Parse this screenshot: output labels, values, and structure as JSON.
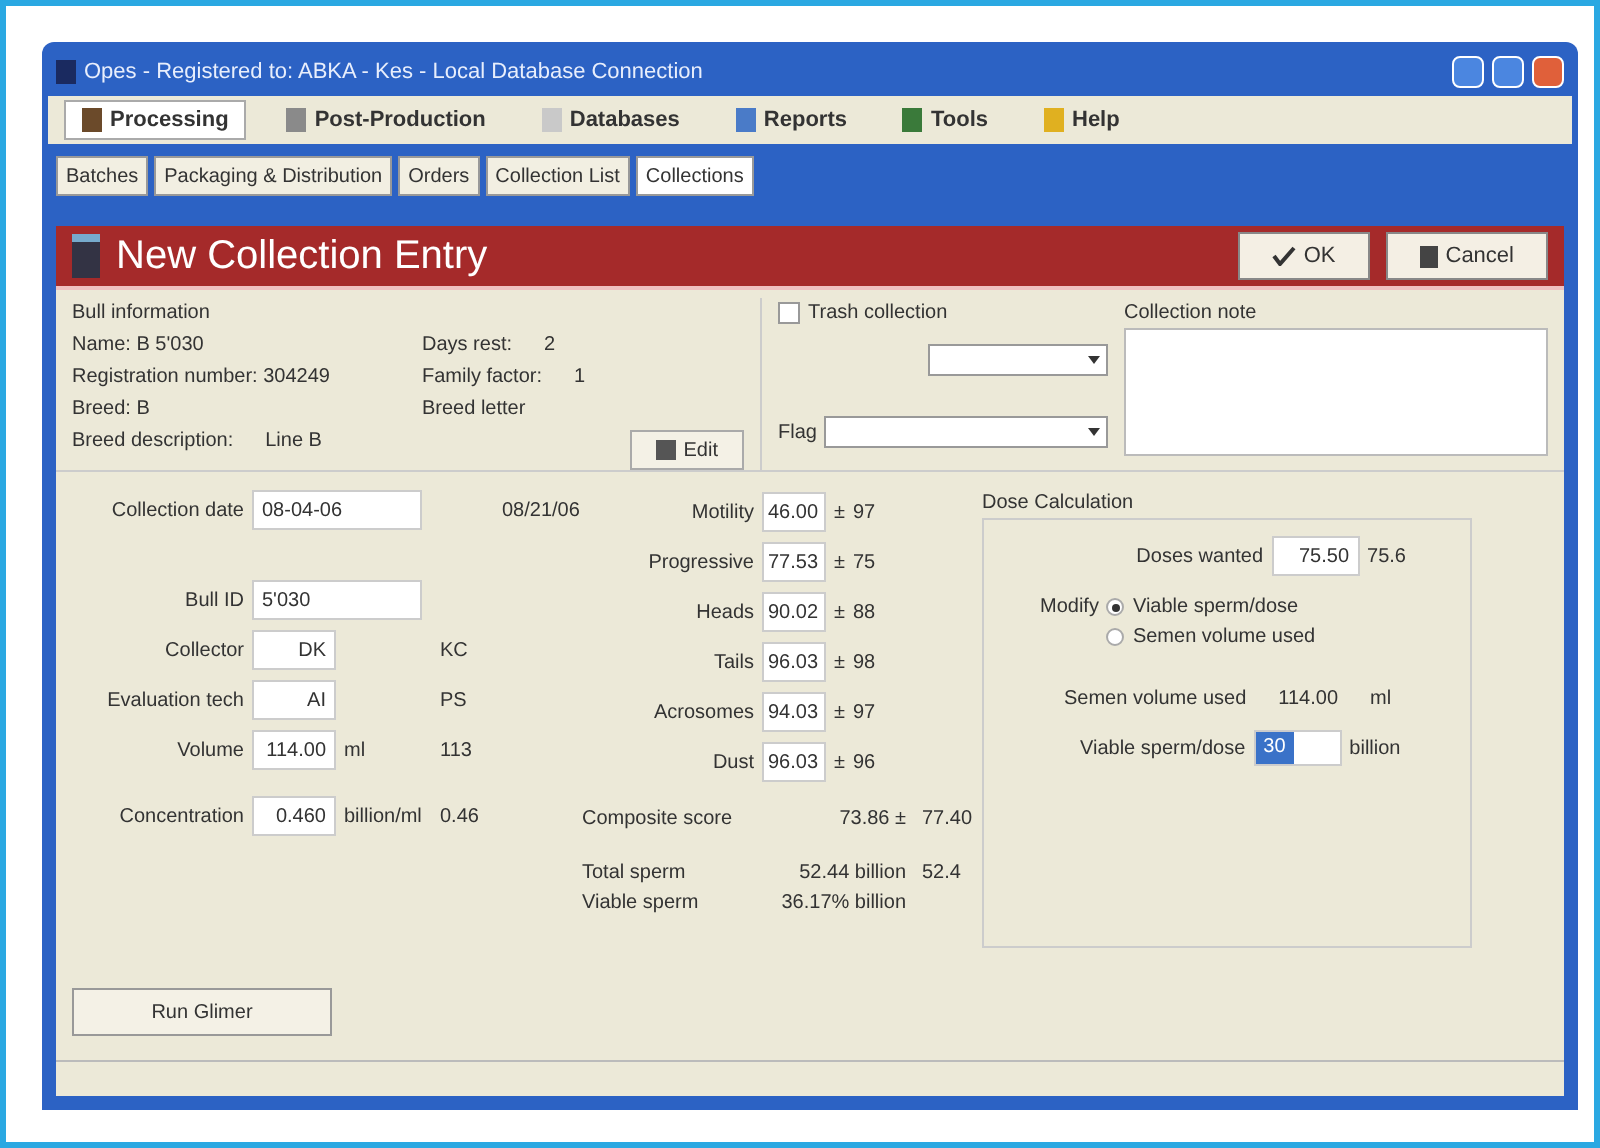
{
  "window": {
    "title": "Opes - Registered to: ABKA - Kes - Local Database Connection"
  },
  "menu": [
    {
      "label": "Processing",
      "selected": true
    },
    {
      "label": "Post-Production",
      "selected": false
    },
    {
      "label": "Databases",
      "selected": false
    },
    {
      "label": "Reports",
      "selected": false
    },
    {
      "label": "Tools",
      "selected": false
    },
    {
      "label": "Help",
      "selected": false
    }
  ],
  "tabs": [
    {
      "label": "Batches",
      "selected": false
    },
    {
      "label": "Packaging & Distribution",
      "selected": false
    },
    {
      "label": "Orders",
      "selected": false
    },
    {
      "label": "Collection List",
      "selected": false
    },
    {
      "label": "Collections",
      "selected": true
    }
  ],
  "header": {
    "title": "New Collection Entry",
    "ok": "OK",
    "cancel": "Cancel"
  },
  "bull_info": {
    "heading": "Bull information",
    "rows": [
      {
        "left": "Name: B 5'030",
        "right": "Days rest:",
        "right_value": "2"
      },
      {
        "left": "Registration number: 304249",
        "right": "Family factor:",
        "right_value": "1"
      },
      {
        "left": "Breed: B",
        "right": "Breed letter"
      },
      {
        "left": "Breed description:",
        "left_value": "Line B"
      }
    ],
    "edit_button": "Edit"
  },
  "trash_collection": {
    "label": "Trash collection",
    "checked": false
  },
  "flag": {
    "label": "Flag"
  },
  "collection_note": {
    "label": "Collection note"
  },
  "fields": [
    {
      "label": "Collection date",
      "value": "08-04-06",
      "kind": "wide",
      "reference": "08/21/06"
    },
    {
      "label": "Bull ID",
      "value": "5'030",
      "kind": "wide"
    },
    {
      "label": "Collector",
      "value": "DK",
      "kind": "narrow",
      "reference": "KC"
    },
    {
      "label": "Evaluation tech",
      "value": "AI",
      "kind": "narrow",
      "reference": "PS"
    },
    {
      "label": "Volume",
      "value": "114.00",
      "unit": "ml",
      "kind": "narrow",
      "reference": "113"
    },
    {
      "label": "Concentration",
      "value": "0.460",
      "unit": "billion/ml",
      "kind": "narrow",
      "reference": "0.46"
    }
  ],
  "scores": [
    {
      "label": "Motility",
      "value": "46.00",
      "sign": "±",
      "reference": "97"
    },
    {
      "label": "Progressive",
      "value": "77.53",
      "sign": "±",
      "reference": "75"
    },
    {
      "label": "Heads",
      "value": "90.02",
      "sign": "±",
      "reference": "88"
    },
    {
      "label": "Tails",
      "value": "96.03",
      "sign": "±",
      "reference": "98"
    },
    {
      "label": "Acrosomes",
      "value": "94.03",
      "sign": "±",
      "reference": "97"
    },
    {
      "label": "Dust",
      "value": "96.03",
      "sign": "±",
      "reference": "96"
    }
  ],
  "summary": [
    {
      "label": "Composite score",
      "value": "73.86 ±",
      "reference": "77.40"
    },
    {
      "label": "Total sperm",
      "value": "52.44 billion",
      "reference": "52.4"
    },
    {
      "label": "Viable sperm",
      "value": "36.17% billion"
    }
  ],
  "dose": {
    "heading": "Dose Calculation",
    "doses_label": "Doses wanted",
    "doses_value": "75.50",
    "doses_reference": "75.6",
    "modify_label": "Modify",
    "options": [
      {
        "label": "Viable sperm/dose",
        "selected": true
      },
      {
        "label": "Semen volume used",
        "selected": false
      }
    ],
    "semen_label": "Semen volume used",
    "semen_value": "114.00",
    "semen_unit": "ml",
    "viable_label": "Viable sperm/dose",
    "viable_value": "30",
    "viable_unit": "billion"
  },
  "run_button": "Run Glimer"
}
